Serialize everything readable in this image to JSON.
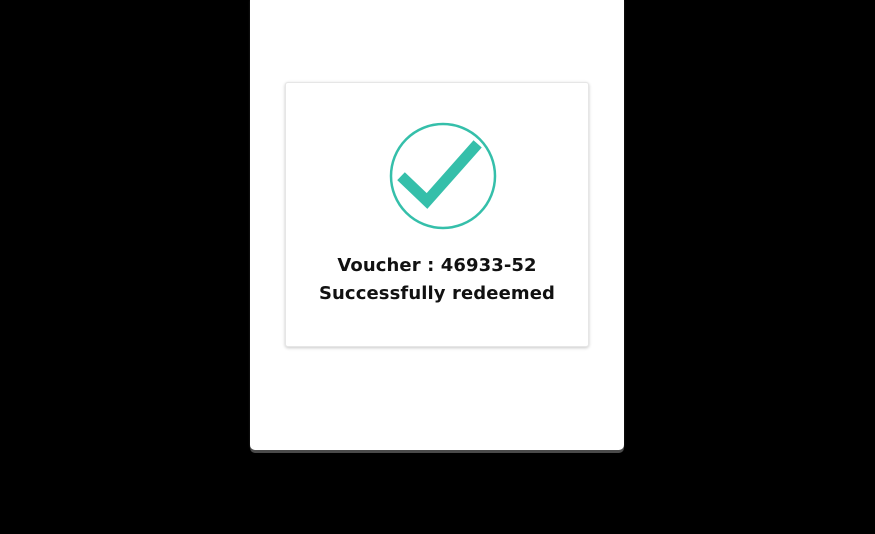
{
  "colors": {
    "accent": "#35bfaa",
    "background": "#000000",
    "panel": "#ffffff",
    "text": "#111111"
  },
  "confirmation": {
    "icon": "check-circle-icon",
    "voucher_label": "Voucher : 46933-52",
    "status_text": "Successfully redeemed"
  }
}
